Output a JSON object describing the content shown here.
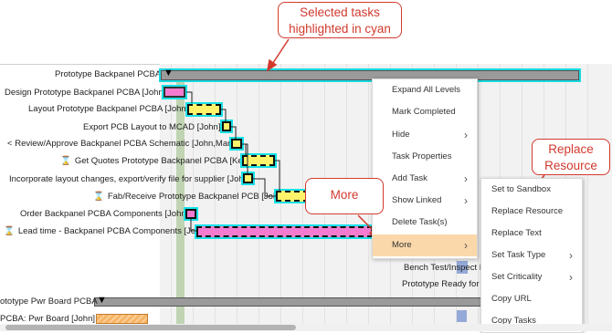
{
  "callouts": {
    "selected": "Selected tasks highlighted in cyan",
    "more": "More",
    "replace_resource": "Replace Resource"
  },
  "rows": [
    {
      "label": "Prototype Backpanel PCBA",
      "icon": ""
    },
    {
      "label": "Design Prototype Backpanel PCBA [John]",
      "icon": ""
    },
    {
      "label": "Layout Prototype Backpanel PCBA [John]",
      "icon": ""
    },
    {
      "label": "Export PCB Layout to MCAD [John]",
      "icon": ""
    },
    {
      "label": "Review/Approve Backpanel PCBA Schematic [John,Mary]",
      "icon": "share-icon"
    },
    {
      "label": "Get Quotes Prototype Backpanel PCBA [Ken]",
      "icon": "hourglass-icon"
    },
    {
      "label": "Incorporate layout changes, export/verify file for supplier [John]",
      "icon": ""
    },
    {
      "label": "Fab/Receive Prototype Backpanel PCB [John]",
      "icon": "hourglass-icon"
    },
    {
      "label": "Order Backpanel PCBA Components [John]",
      "icon": ""
    },
    {
      "label": "Lead time - Backpanel PCBA Components [John]",
      "icon": "hourglass-icon"
    }
  ],
  "lower_rows": [
    {
      "label": "ototype Pwr Board PCBA"
    },
    {
      "label": "PCBA: Pwr Board [John]"
    }
  ],
  "chart_texts": {
    "bench_test": "Bench Test/Inspect Ba",
    "prototype_ready": "Prototype Ready for B"
  },
  "context_menu": [
    {
      "label": "Expand All Levels",
      "submenu": false
    },
    {
      "label": "Mark Completed",
      "submenu": false
    },
    {
      "label": "Hide",
      "submenu": true
    },
    {
      "label": "Task Properties",
      "submenu": false
    },
    {
      "label": "Add Task",
      "submenu": true
    },
    {
      "label": "Show Linked",
      "submenu": true
    },
    {
      "label": "Delete Task(s)",
      "submenu": false
    },
    {
      "label": "More",
      "submenu": true,
      "active": true
    }
  ],
  "submenu": [
    {
      "label": "Set to Sandbox",
      "submenu": false
    },
    {
      "label": "Replace Resource",
      "submenu": false
    },
    {
      "label": "Replace Text",
      "submenu": false
    },
    {
      "label": "Set Task Type",
      "submenu": true
    },
    {
      "label": "Set Criticality",
      "submenu": true
    },
    {
      "label": "Copy URL",
      "submenu": false
    },
    {
      "label": "Copy Tasks",
      "submenu": false
    }
  ],
  "colors": {
    "highlight": "#18e1e7",
    "callout": "#d23a2f",
    "task_yellow": "#fff36b",
    "task_pink": "#f57bd0",
    "menu_active": "#fbd8a9"
  }
}
